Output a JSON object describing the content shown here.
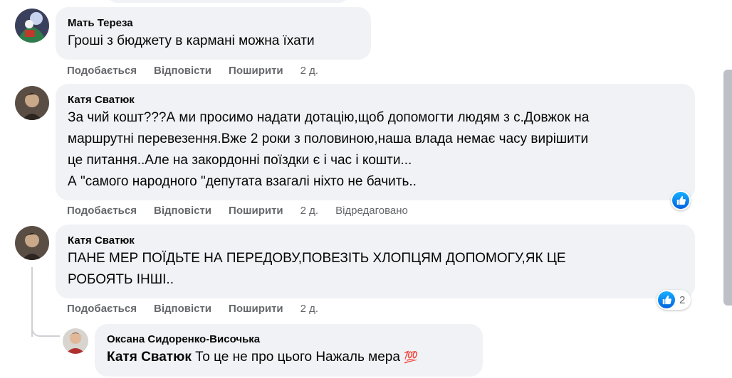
{
  "comments": [
    {
      "author": "Мать Тереза",
      "lines": [
        "Гроші з бюджету в кармані можна їхати"
      ],
      "actions": {
        "like": "Подобається",
        "reply": "Відповісти",
        "share": "Поширити",
        "time": "2 д."
      }
    },
    {
      "author": "Катя Сватюк",
      "lines": [
        "За чий кошт???А ми просимо надати дотацію,щоб допомогти людям з с.Довжок на",
        "маршрутні перевезення.Вже 2 роки з половиною,наша влада немає часу вирішити",
        "це питання..Але на закордонні поїздки є і час і кошти...",
        "А \"самого народного \"депутата взагалі ніхто не бачить.."
      ],
      "actions": {
        "like": "Подобається",
        "reply": "Відповісти",
        "share": "Поширити",
        "time": "2 д.",
        "edited": "Відредаговано"
      },
      "reaction": {
        "icon": "like-icon",
        "count": ""
      }
    },
    {
      "author": "Катя Сватюк",
      "lines": [
        "ПАНЕ МЕР ПОЇДЬТЕ НА ПЕРЕДОВУ,ПОВЕЗІТЬ ХЛОПЦЯМ ДОПОМОГУ,ЯК ЦЕ",
        "РОБОЯТЬ ІНШІ.."
      ],
      "actions": {
        "like": "Подобається",
        "reply": "Відповісти",
        "share": "Поширити",
        "time": "2 д."
      },
      "reaction": {
        "icon": "like-icon",
        "count": "2"
      }
    }
  ],
  "reply": {
    "author": "Оксана Сидоренко-Височька",
    "mention": "Катя Сватюк",
    "text": " То це не про цього Нажаль мера ",
    "emoji": "💯"
  },
  "colors": {
    "bubble": "#f0f2f5",
    "meta": "#65676b",
    "like": "#1877f2"
  }
}
